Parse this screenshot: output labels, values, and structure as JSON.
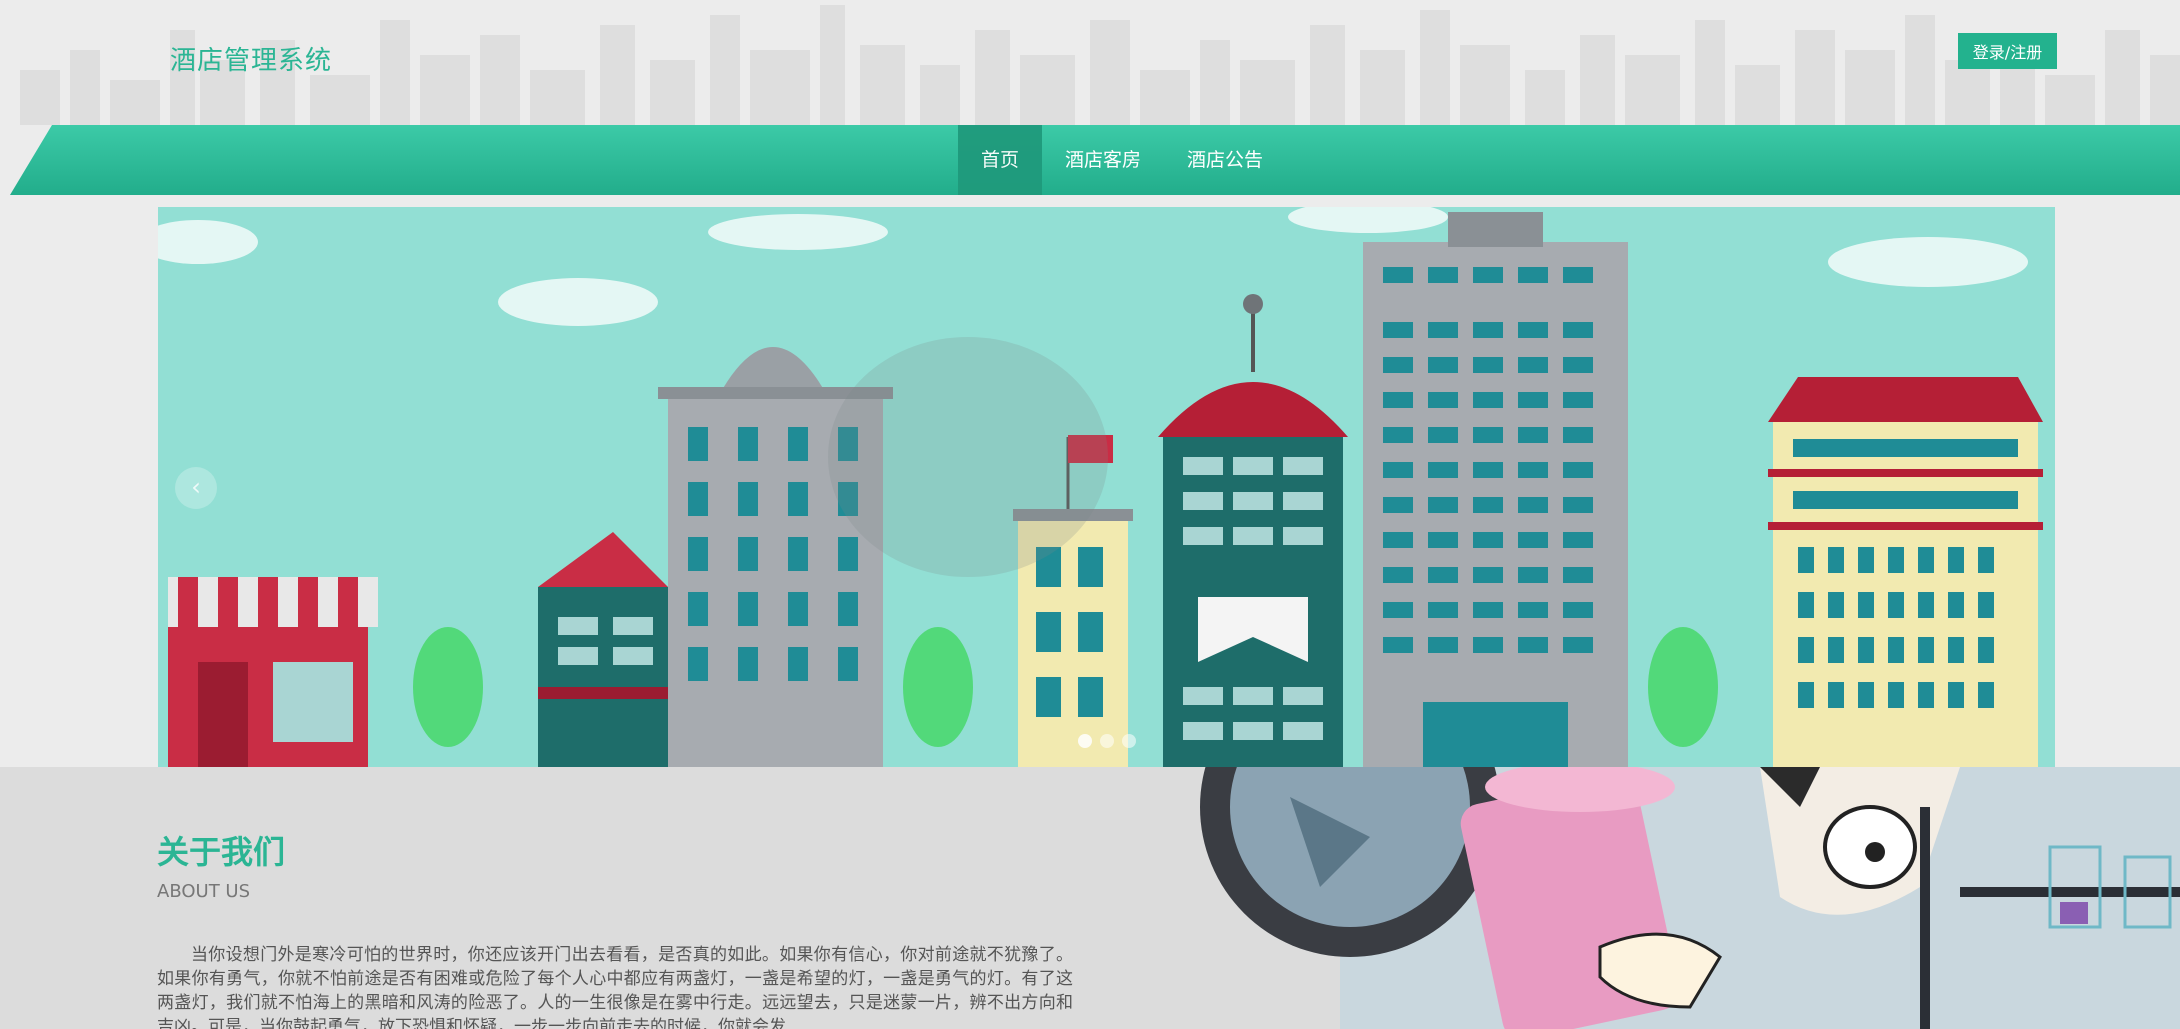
{
  "header": {
    "site_title": "酒店管理系统",
    "login_label": "登录/注册"
  },
  "nav": {
    "items": [
      {
        "label": "首页",
        "active": true
      },
      {
        "label": "酒店客房",
        "active": false
      },
      {
        "label": "酒店公告",
        "active": false
      }
    ]
  },
  "banner": {
    "prev_icon": "chevron-left-icon",
    "prev_glyph": "‹",
    "slide_count": 3
  },
  "about": {
    "title": "关于我们",
    "subtitle": "ABOUT US",
    "text": "当你设想门外是寒冷可怕的世界时，你还应该开门出去看看，是否真的如此。如果你有信心，你对前途就不犹豫了。如果你有勇气，你就不怕前途是否有困难或危险了每个人心中都应有两盏灯，一盏是希望的灯，一盏是勇气的灯。有了这两盏灯，我们就不怕海上的黑暗和风涛的险恶了。人的一生很像是在雾中行走。远远望去，只是迷蒙一片，辨不出方向和吉凶。可是，当你鼓起勇气，放下恐惧和怀疑，一步一步向前走去的时候，你就会发"
  },
  "colors": {
    "accent": "#2bb594",
    "button": "#23b28e",
    "nav": "#33c4a1"
  }
}
